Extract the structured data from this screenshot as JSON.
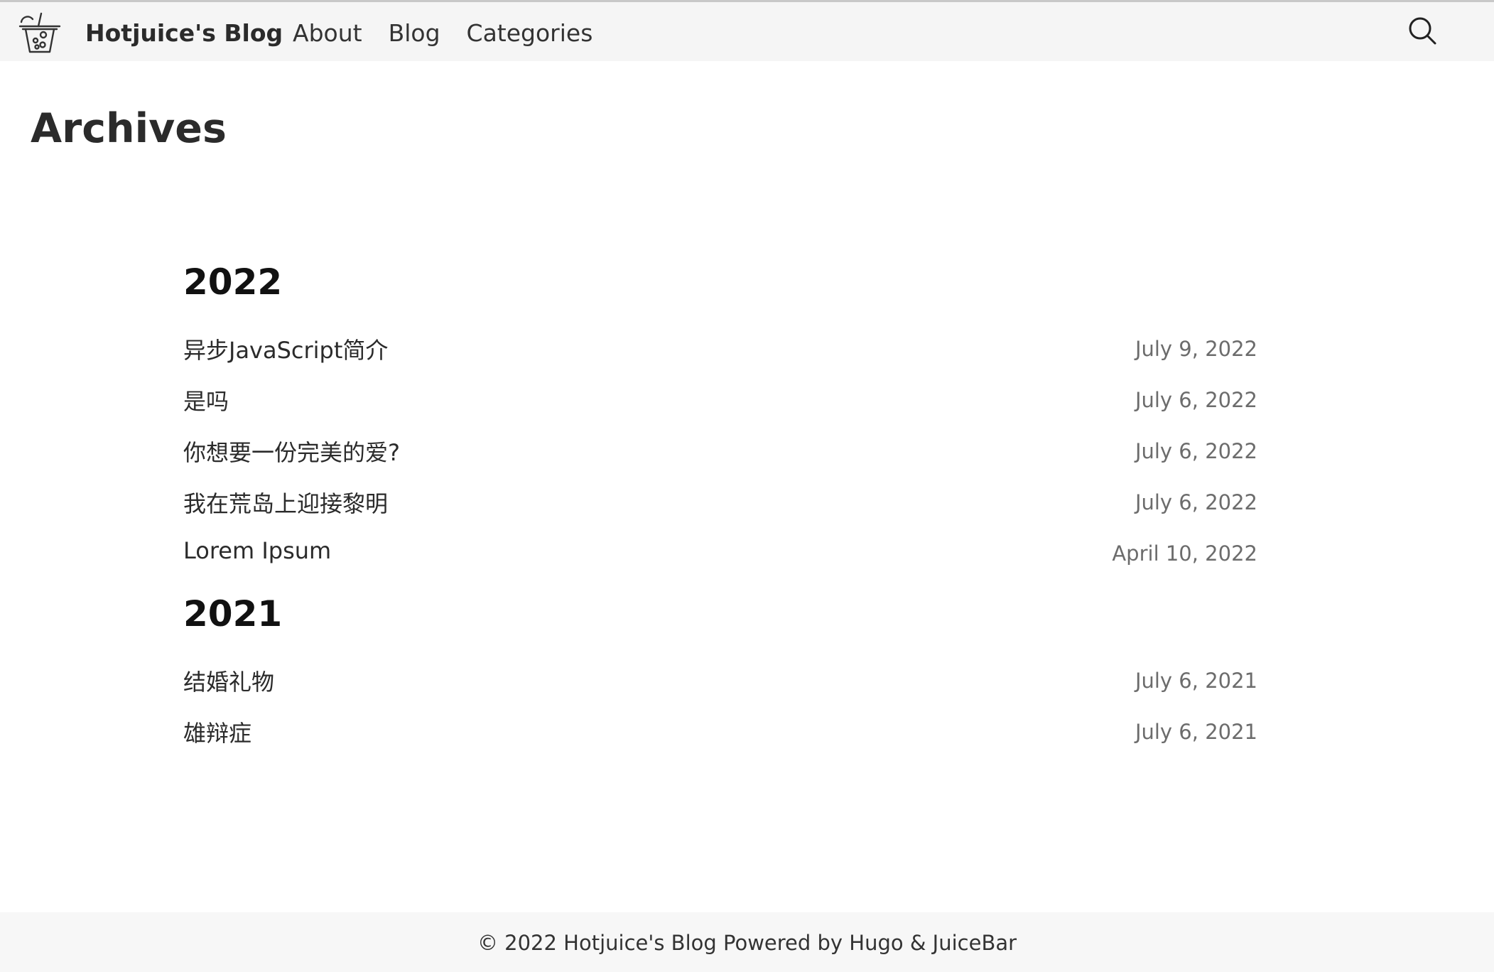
{
  "header": {
    "brand": "Hotjuice's Blog",
    "nav": [
      "About",
      "Blog",
      "Categories"
    ],
    "logo_icon": "bubble-tea-icon",
    "search_icon": "search-icon"
  },
  "page": {
    "title": "Archives"
  },
  "archives": [
    {
      "year": "2022",
      "posts": [
        {
          "title": "异步JavaScript简介",
          "date": "July 9, 2022"
        },
        {
          "title": "是吗",
          "date": "July 6, 2022"
        },
        {
          "title": "你想要一份完美的爱?",
          "date": "July 6, 2022"
        },
        {
          "title": "我在荒岛上迎接黎明",
          "date": "July 6, 2022"
        },
        {
          "title": "Lorem Ipsum",
          "date": "April 10, 2022"
        }
      ]
    },
    {
      "year": "2021",
      "posts": [
        {
          "title": "结婚礼物",
          "date": "July 6, 2021"
        },
        {
          "title": "雄辩症",
          "date": "July 6, 2021"
        }
      ]
    }
  ],
  "footer": {
    "text": "© 2022 Hotjuice's Blog Powered by Hugo & JuiceBar"
  }
}
